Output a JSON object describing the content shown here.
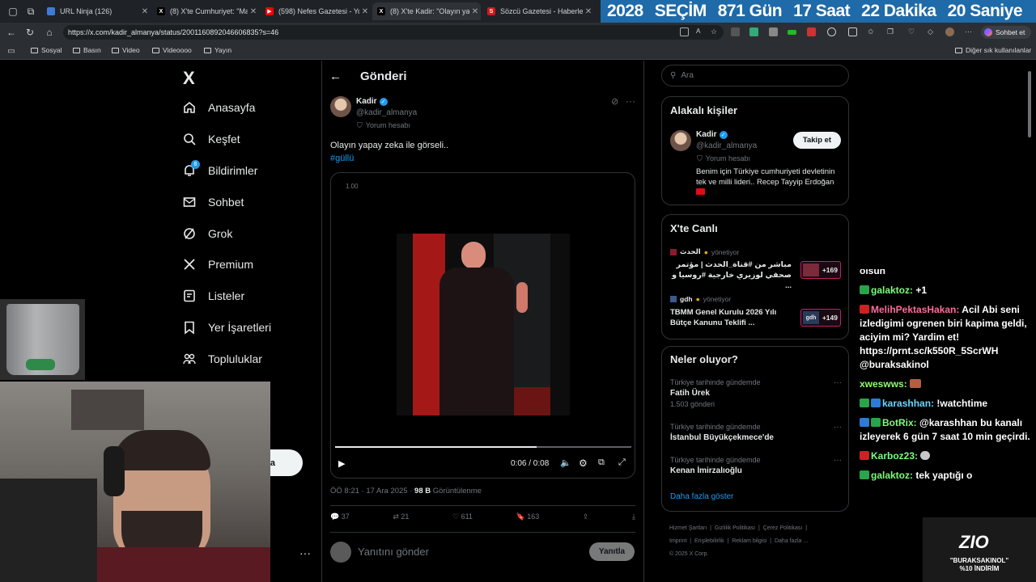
{
  "tabs": [
    {
      "title": "URL Ninja (126)",
      "favicon_color": "#3f7ad6"
    },
    {
      "title": "(8) X'te Cumhuriyet: \"Marke",
      "favicon_color": "#000000"
    },
    {
      "title": "(598) Nefes Gazetesi - YouT",
      "favicon_color": "#ff0000"
    },
    {
      "title": "(8) X'te Kadir: \"Olayın yapay",
      "favicon_color": "#000000"
    },
    {
      "title": "Sözcü Gazetesi - Haberler, .",
      "favicon_color": "#d0191a"
    }
  ],
  "countdown": {
    "label": "2028",
    "election": "SEÇİM",
    "days": "871 Gün",
    "hours": "17 Saat",
    "minutes": "22 Dakika",
    "seconds": "20 Saniye"
  },
  "browser": {
    "url": "https://x.com/kadir_almanya/status/2001160892046606835?s=46",
    "chat_button": "Sohbet et"
  },
  "bookmarks": {
    "items": [
      "Sosyal",
      "Basın",
      "Video",
      "Videoooo",
      "Yayın"
    ],
    "other": "Diğer sık kullanılanlar"
  },
  "nav": {
    "logo": "X",
    "items": [
      {
        "label": "Anasayfa",
        "icon": "home-icon"
      },
      {
        "label": "Keşfet",
        "icon": "search-icon"
      },
      {
        "label": "Bildirimler",
        "icon": "bell-icon",
        "badge": "8"
      },
      {
        "label": "Sohbet",
        "icon": "mail-icon"
      },
      {
        "label": "Grok",
        "icon": "grok-icon"
      },
      {
        "label": "Premium",
        "icon": "x-icon"
      },
      {
        "label": "Listeler",
        "icon": "list-icon"
      },
      {
        "label": "Yer İşaretleri",
        "icon": "bookmark-icon"
      },
      {
        "label": "Topluluklar",
        "icon": "communities-icon"
      }
    ],
    "post_button_fragment": "a"
  },
  "post": {
    "header_title": "Gönderi",
    "author_name": "Kadir",
    "author_handle": "@kadir_almanya",
    "author_sub": "Yorum hesabı",
    "text": "Olayın yapay zeka ile görseli..",
    "hashtag": "#güllü",
    "video": {
      "speed": "1.00",
      "time": "0:06 / 0:08",
      "progress": 0.68
    },
    "meta_time": "ÖÖ 8:21 · 17 Ara 2025 · ",
    "views": "98 B",
    "views_label": "Görüntülenme",
    "stats": {
      "replies": "37",
      "reposts": "21",
      "likes": "611",
      "bookmarks": "163"
    },
    "reply_placeholder": "Yanıtını gönder",
    "reply_button": "Yanıtla"
  },
  "sidebar": {
    "search_placeholder": "Ara",
    "related": {
      "title": "Alakalı kişiler",
      "name": "Kadir",
      "handle": "@kadir_almanya",
      "sub": "Yorum hesabı",
      "bio": "Benim için Türkiye cumhuriyeti devletinin tek ve milli lideri.. Recep Tayyip Erdoğan",
      "follow": "Takip et"
    },
    "live": {
      "title": "X'te Canlı",
      "items": [
        {
          "source": "الحدث",
          "role": "yönetiyor",
          "text": "مباشر من #قناة_الحدث | مؤتمر صحفي لوزيري خارجية #روسيا و ...",
          "count": "+169"
        },
        {
          "source": "gdh",
          "role": "yönetiyor",
          "text": "TBMM Genel Kurulu 2026 Yılı Bütçe Kanunu Teklifi ...",
          "count": "+149"
        }
      ]
    },
    "trends": {
      "title": "Neler oluyor?",
      "items": [
        {
          "context": "Türkiye tarihinde gündemde",
          "name": "Fatih Ürek",
          "count": "1.503 gönderi"
        },
        {
          "context": "Türkiye tarihinde gündemde",
          "name": "İstanbul Büyükçekmece'de",
          "count": ""
        },
        {
          "context": "Türkiye tarihinde gündemde",
          "name": "Kenan İmirzalıoğlu",
          "count": ""
        }
      ],
      "more": "Daha fazla göster"
    },
    "footer": [
      "Hizmet Şartları",
      "Gizlilik Politikası",
      "Çerez Politikası",
      "Imprint",
      "Erişilebilirlik",
      "Reklam bilgisi",
      "Daha fazla ...",
      "© 2025 X Corp."
    ]
  },
  "chat": {
    "messages": [
      {
        "user": "",
        "text": "olsun",
        "color": "#ffffff"
      },
      {
        "user": "galaktoz:",
        "text": "+1",
        "color": "#7cfc7c",
        "badge": "#2aa44a"
      },
      {
        "user": "MelihPektasHakan:",
        "text": "Acil Abi seni izledigimi ogrenen biri kapima geldi, aciyim mi? Yardim et! https://prnt.sc/k550R_5ScrWH @buraksakinol",
        "color": "#ff6b9d",
        "badge": "#cc2222"
      },
      {
        "user": "xweswws:",
        "text": "",
        "color": "#8cff6e",
        "badge": ""
      },
      {
        "user": "karashhan:",
        "text": "!watchtime",
        "color": "#6ad6ff",
        "badge": "#2aa44a"
      },
      {
        "user": "BotRix:",
        "text": "@karashhan bu kanalı izleyerek 6 gün 7 saat 10 min geçirdi.",
        "color": "#7cfc7c",
        "badge": "#2f7ad6"
      },
      {
        "user": "Karboz23:",
        "text": "",
        "color": "#ff5c5c",
        "badge": "#cc2222"
      },
      {
        "user": "galaktoz:",
        "text": "tek yaptığı o",
        "color": "#7cfc7c",
        "badge": "#2aa44a"
      }
    ]
  },
  "overlay": {
    "brand": "ZIO",
    "promo": "\"BURAKSAKINOL\"",
    "discount": "%10 İNDİRİM"
  }
}
